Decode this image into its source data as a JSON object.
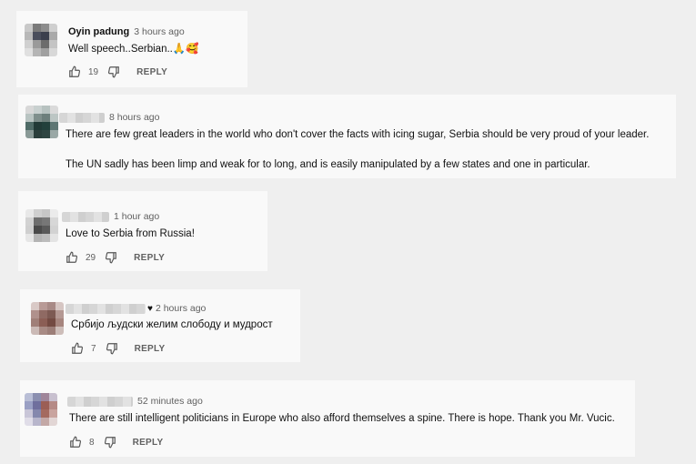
{
  "comments": [
    {
      "author": "Oyin padung",
      "time": "3 hours ago",
      "text": "Well speech..Serbian..🙏🥰",
      "likes": "19",
      "reply": "REPLY"
    },
    {
      "author": "",
      "time": "8 hours ago",
      "text1": "There are few great leaders in the world who don't cover the facts with icing sugar, Serbia should be very proud of your leader.",
      "text2": "The UN sadly has been limp and weak for to long, and is easily manipulated by a few states and one in particular."
    },
    {
      "author": "",
      "time": "1 hour ago",
      "text": "Love to Serbia from Russia!",
      "likes": "29",
      "reply": "REPLY"
    },
    {
      "author": "",
      "time": "2 hours ago",
      "heart": "♥",
      "text": "Србијо људски желим слободу и мудрост",
      "likes": "7",
      "reply": "REPLY"
    },
    {
      "author": "",
      "time": "52 minutes ago",
      "text": "There are still intelligent politicians in Europe who also afford themselves a spine. There is hope. Thank you Mr. Vucic.",
      "likes": "8",
      "reply": "REPLY"
    }
  ],
  "colors": {
    "background": "#efefef",
    "card": "#f9f9f9",
    "secondary_text": "#606060"
  },
  "icons": {
    "like": "thumb-up-icon",
    "dislike": "thumb-down-icon"
  }
}
